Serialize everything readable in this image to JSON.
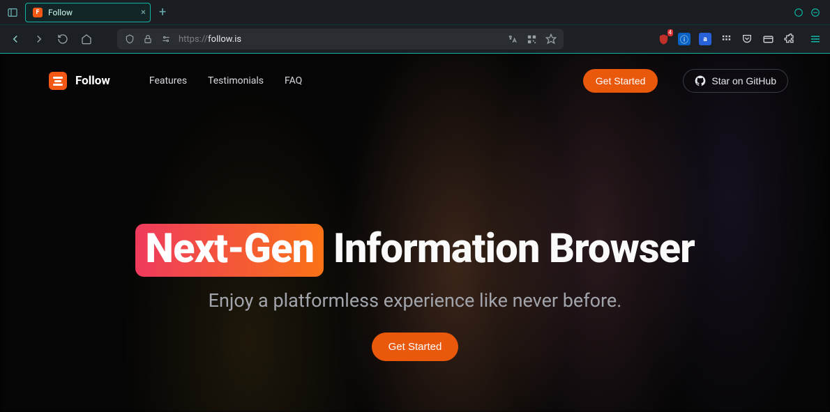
{
  "browser": {
    "tab_title": "Follow",
    "url_prefix": "https://",
    "url_host": "follow.is",
    "url_path": "",
    "extension_badge": "4"
  },
  "site": {
    "brand": "Follow",
    "nav": {
      "features": "Features",
      "testimonials": "Testimonials",
      "faq": "FAQ"
    },
    "header_cta": "Get Started",
    "github_cta": "Star on GitHub"
  },
  "hero": {
    "highlight": "Next-Gen",
    "rest": "Information Browser",
    "subtitle": "Enjoy a platformless experience like never before.",
    "cta": "Get Started"
  },
  "colors": {
    "accent": "#ea580c",
    "teal": "#0fb5a5"
  }
}
